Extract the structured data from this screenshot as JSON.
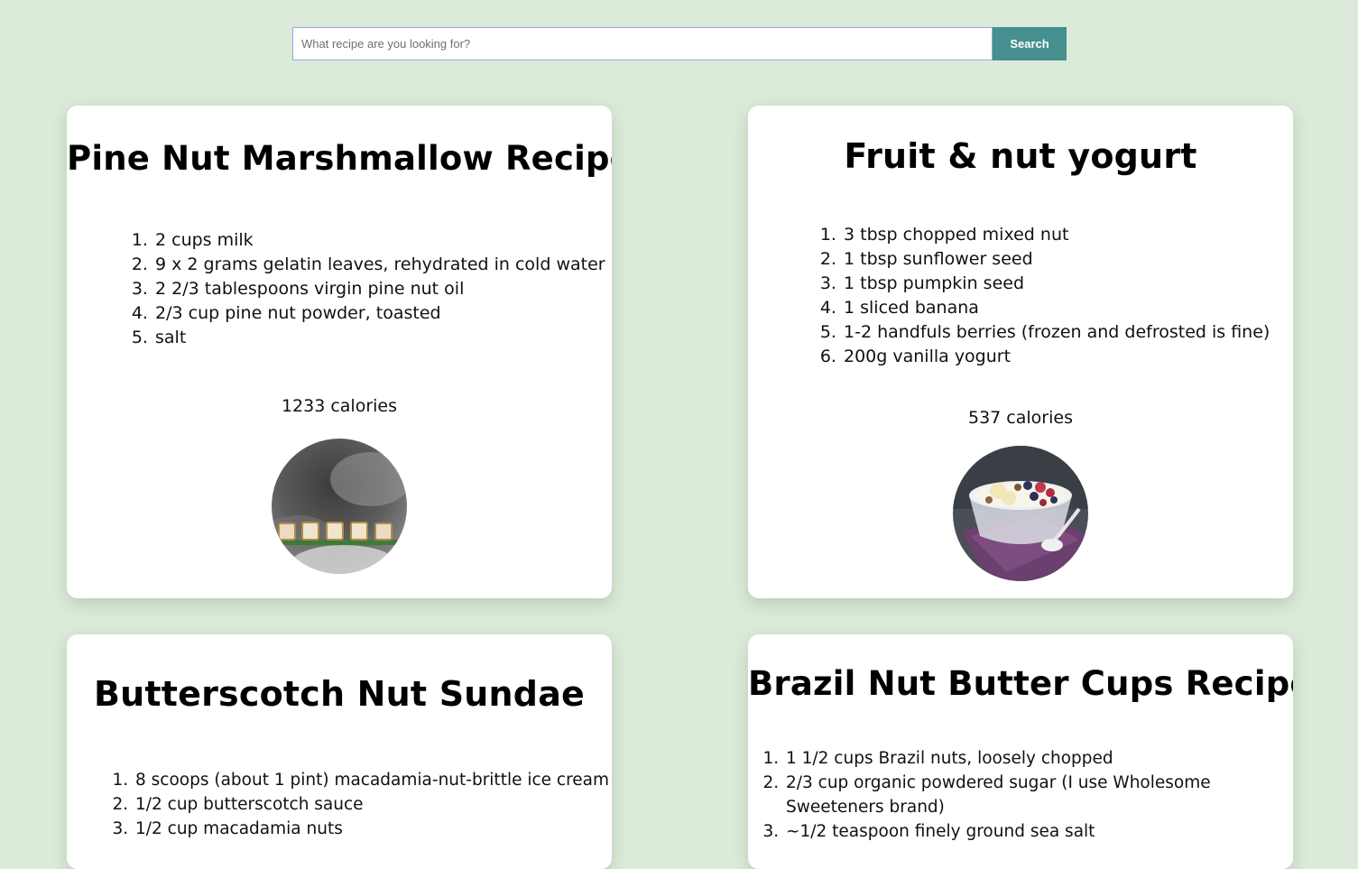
{
  "search": {
    "placeholder": "What recipe are you looking for?",
    "button_label": "Search"
  },
  "recipes": [
    {
      "title": "Pine Nut Marshmallow Recipe",
      "ingredients": [
        "2 cups milk",
        "9 x 2 grams gelatin leaves, rehydrated in cold water",
        "2 2/3 tablespoons virgin pine nut oil",
        "2/3 cup pine nut powder, toasted",
        "salt"
      ],
      "calories": "1233 calories",
      "image": "marshmallow-photo"
    },
    {
      "title": "Fruit & nut yogurt",
      "ingredients": [
        "3 tbsp chopped mixed nut",
        "1 tbsp sunflower seed",
        "1 tbsp pumpkin seed",
        "1 sliced banana",
        "1-2 handfuls berries (frozen and defrosted is fine)",
        "200g vanilla yogurt"
      ],
      "calories": "537 calories",
      "image": "yogurt-bowl-photo"
    },
    {
      "title": "Butterscotch Nut Sundae",
      "ingredients": [
        "8 scoops (about 1 pint) macadamia-nut-brittle ice cream",
        "1/2 cup butterscotch sauce",
        "1/2 cup macadamia nuts"
      ]
    },
    {
      "title": "Brazil Nut Butter Cups Recipe",
      "ingredients": [
        "1 1/2 cups Brazil nuts, loosely chopped",
        "2/3 cup organic powdered sugar (I use Wholesome Sweeteners brand)",
        "~1/2 teaspoon finely ground sea salt"
      ]
    }
  ]
}
